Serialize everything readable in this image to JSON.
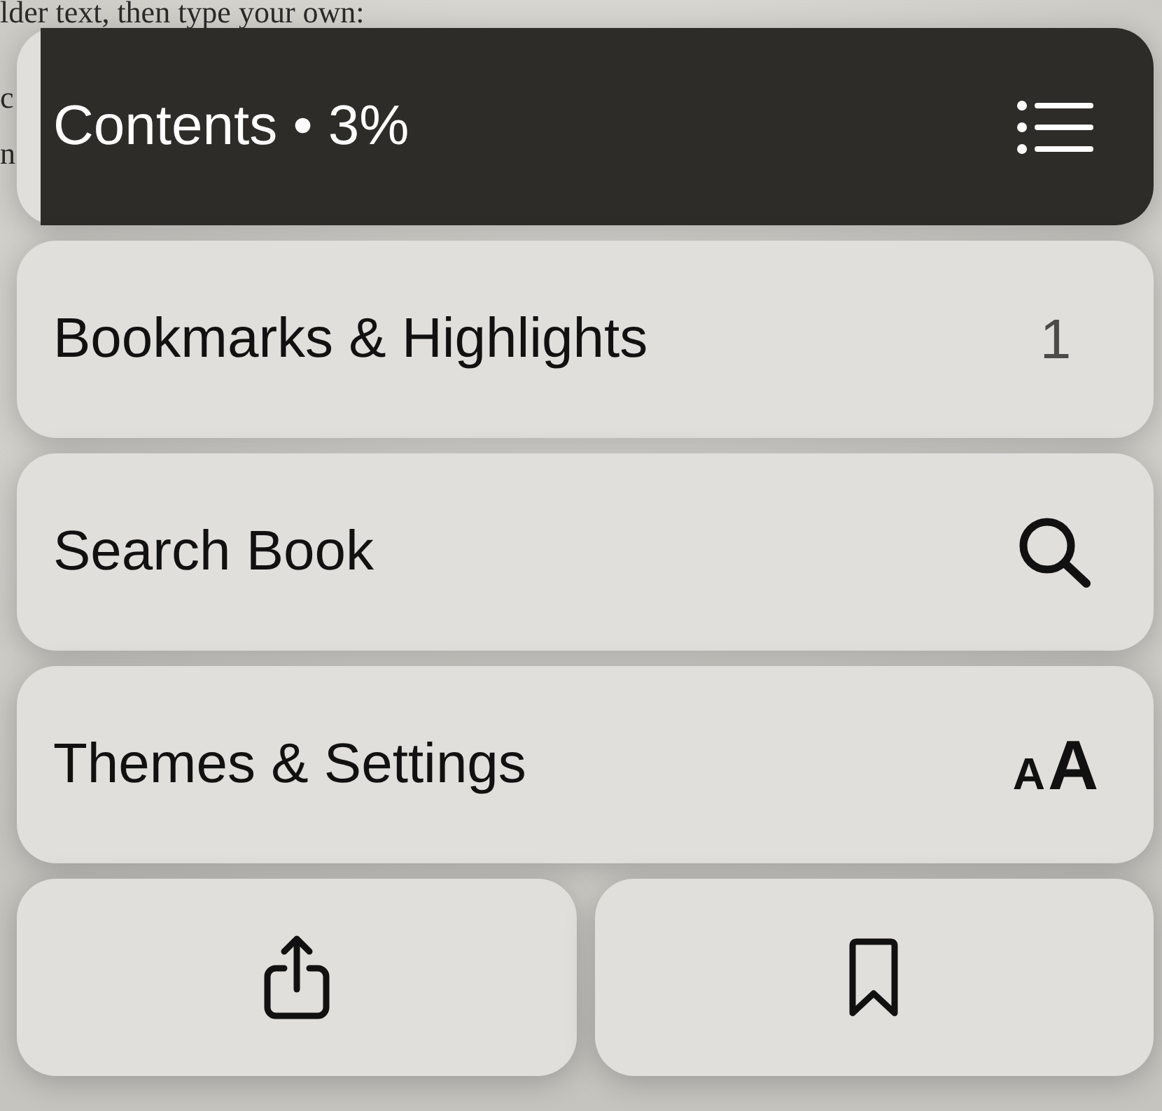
{
  "page_text": [
    "lder text, then type your own:",
    "c",
    "n"
  ],
  "menu": {
    "items": [
      {
        "kind": "contents",
        "label": "Contents • 3%",
        "highlighted": true
      },
      {
        "kind": "count",
        "label": "Bookmarks & Highlights",
        "count": "1",
        "highlighted": false
      },
      {
        "kind": "search",
        "label": "Search Book",
        "highlighted": false
      },
      {
        "kind": "glyphs",
        "label": "Themes & Settings",
        "glyphs": [
          "A",
          "A"
        ],
        "highlighted": false
      }
    ],
    "actions": [
      {
        "kind": "share"
      },
      {
        "kind": "bookmark"
      }
    ]
  }
}
